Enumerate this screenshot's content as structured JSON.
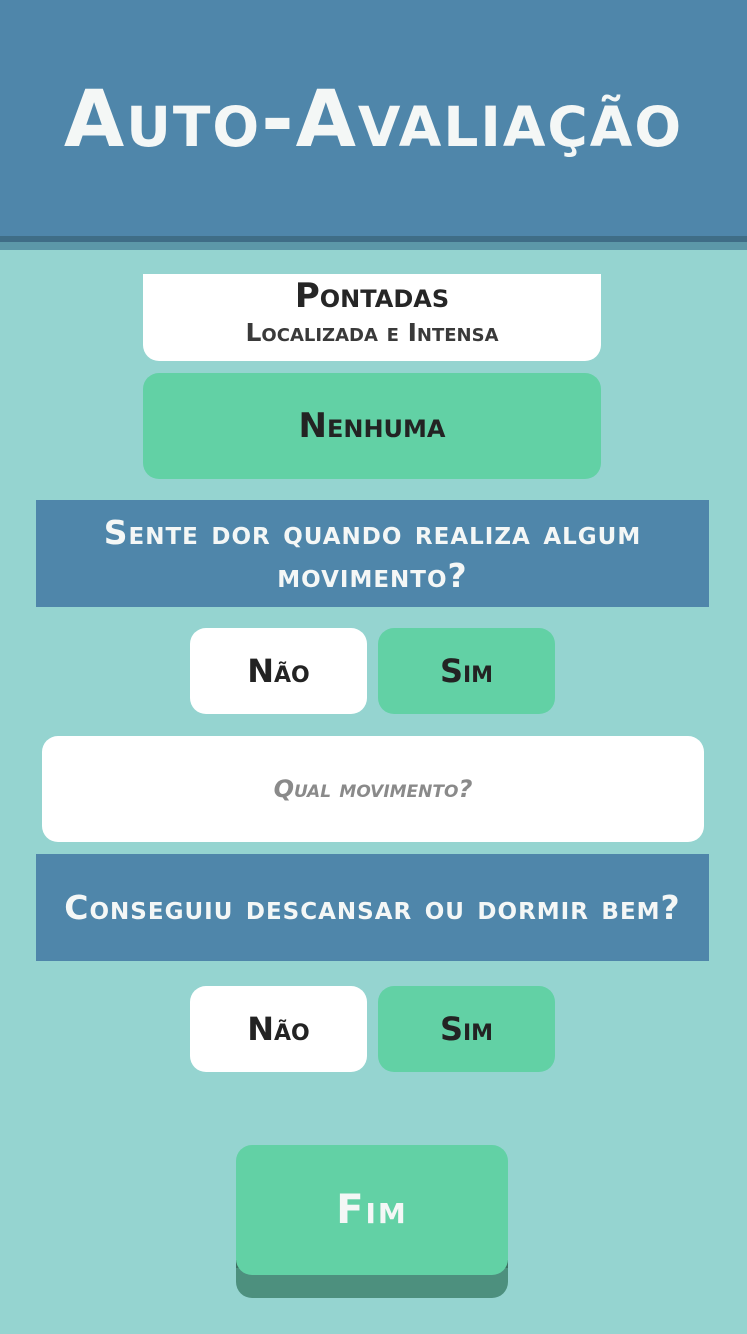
{
  "header": {
    "title": "Auto-Avaliação"
  },
  "pain_type": {
    "title": "Pontadas",
    "subtitle": "Localizada e Intensa"
  },
  "option_none": {
    "label": "Nenhuma"
  },
  "question_movement": {
    "text": "Sente dor quando realiza algum movimento?",
    "no_label": "Não",
    "yes_label": "Sim"
  },
  "movement_input": {
    "placeholder": "Qual movimento?",
    "value": ""
  },
  "question_sleep": {
    "text": "Conseguiu descansar ou dormir bem?",
    "no_label": "Não",
    "yes_label": "Sim"
  },
  "finish": {
    "label": "Fim"
  },
  "colors": {
    "background": "#95d4d0",
    "header": "#4f86aa",
    "accent_green": "#62d1a5",
    "card_white": "#ffffff",
    "dark_text": "#232323",
    "light_text": "#f4f7f6"
  }
}
